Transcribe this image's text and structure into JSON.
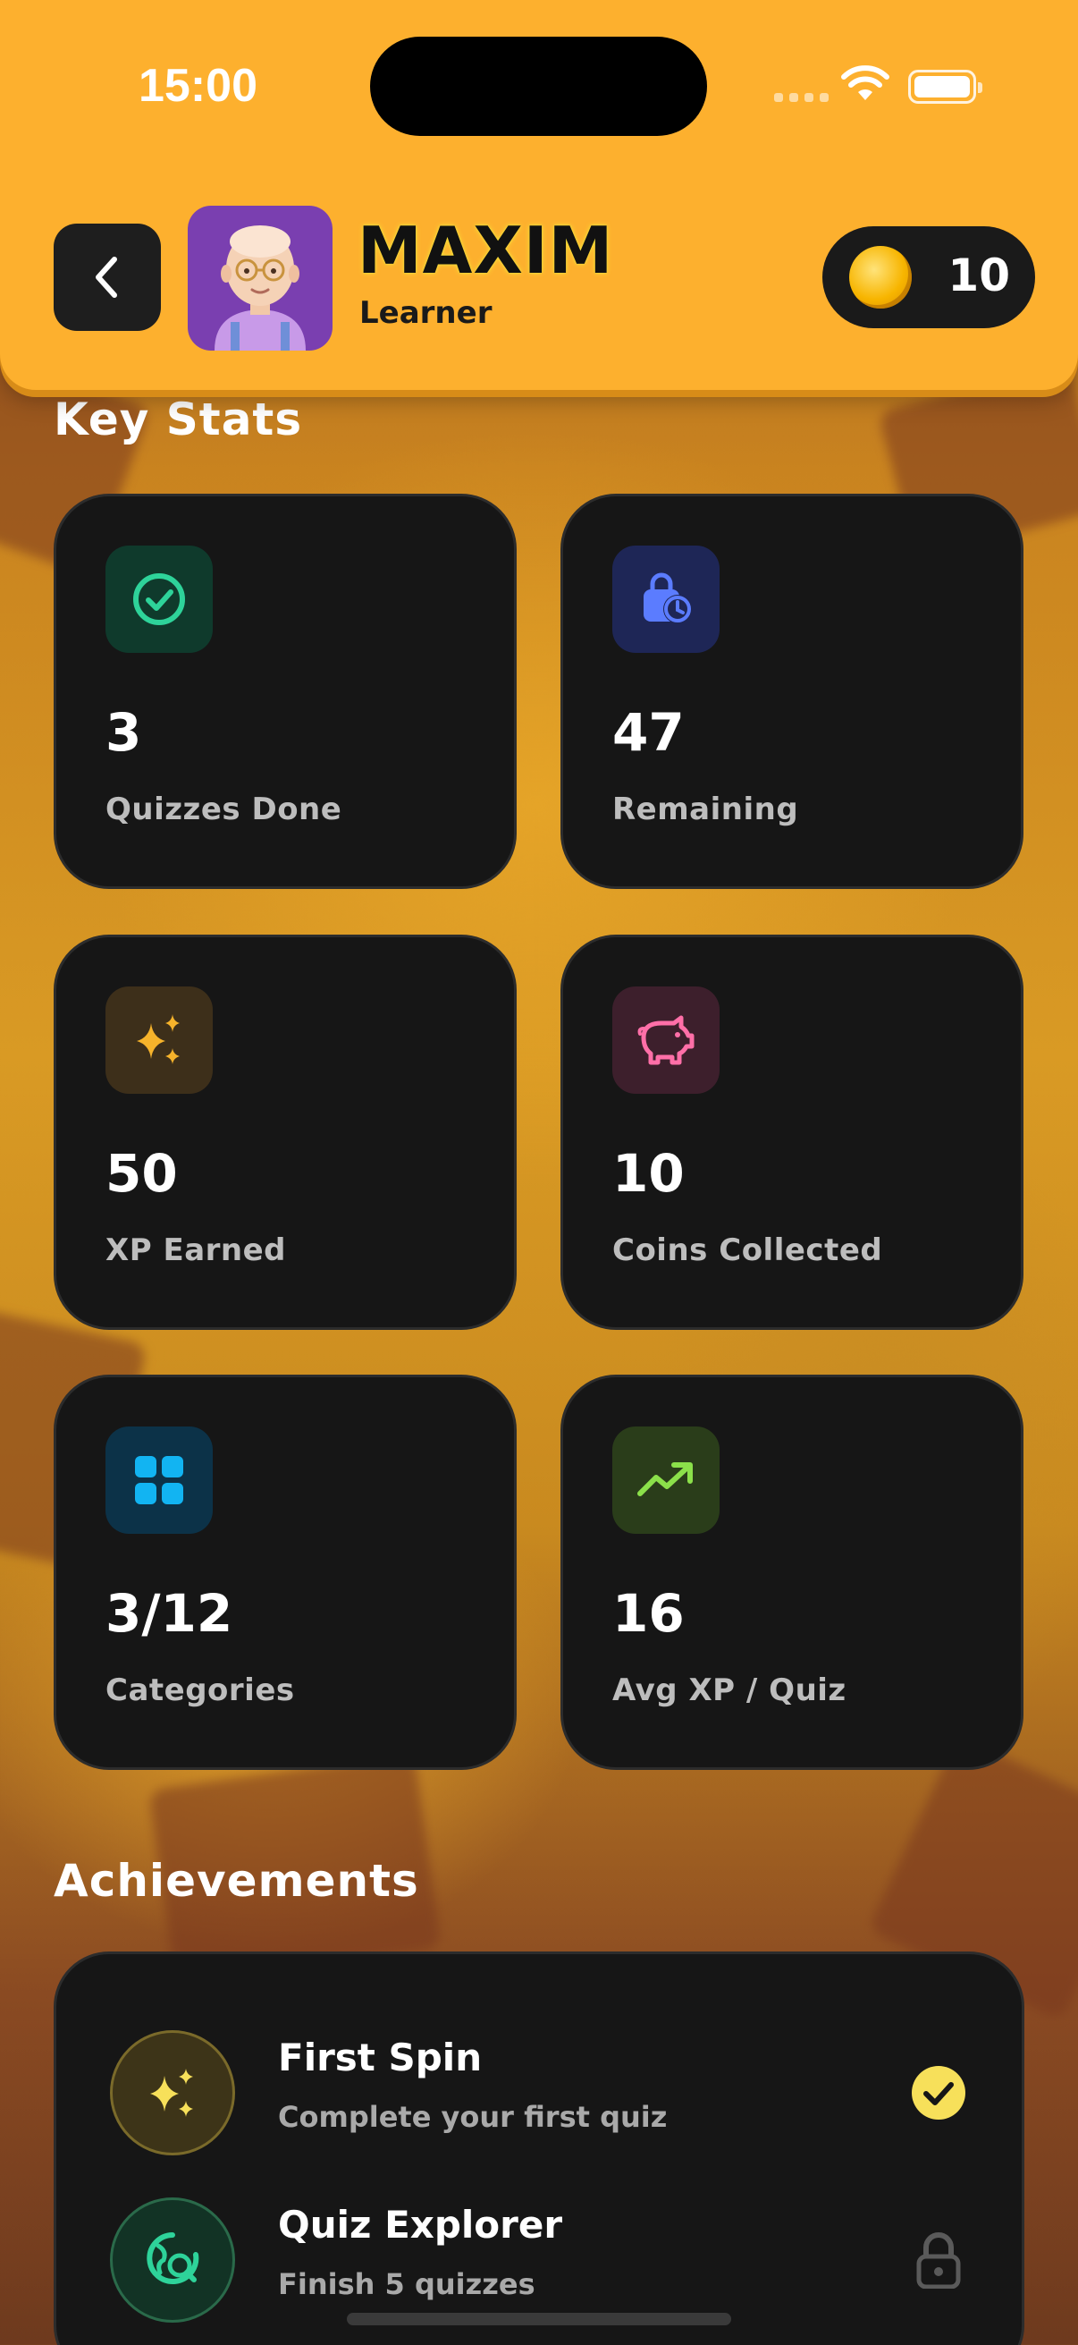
{
  "status_bar": {
    "time": "15:00"
  },
  "header": {
    "user_name": "MAXIM",
    "user_role": "Learner",
    "coins": "10"
  },
  "key_stats": {
    "title": "Key Stats",
    "cards": [
      {
        "value": "3",
        "label": "Quizzes Done",
        "icon": "check-circle-icon",
        "color": "#2ed39a"
      },
      {
        "value": "47",
        "label": "Remaining",
        "icon": "bag-clock-icon",
        "color": "#5b7cff"
      },
      {
        "value": "50",
        "label": "XP Earned",
        "icon": "sparkles-icon",
        "color": "#f6b32b"
      },
      {
        "value": "10",
        "label": "Coins Collected",
        "icon": "piggy-bank-icon",
        "color": "#ff6fa8"
      },
      {
        "value": "3/12",
        "label": "Categories",
        "icon": "grid-icon",
        "color": "#12b4f2"
      },
      {
        "value": "16",
        "label": "Avg XP / Quiz",
        "icon": "trending-up-icon",
        "color": "#8be04a"
      }
    ]
  },
  "achievements": {
    "title": "Achievements",
    "items": [
      {
        "title": "First Spin",
        "description": "Complete your first quiz",
        "status": "unlocked",
        "icon": "sparkles-icon"
      },
      {
        "title": "Quiz Explorer",
        "description": "Finish 5 quizzes",
        "status": "locked",
        "icon": "globe-search-icon"
      }
    ]
  }
}
